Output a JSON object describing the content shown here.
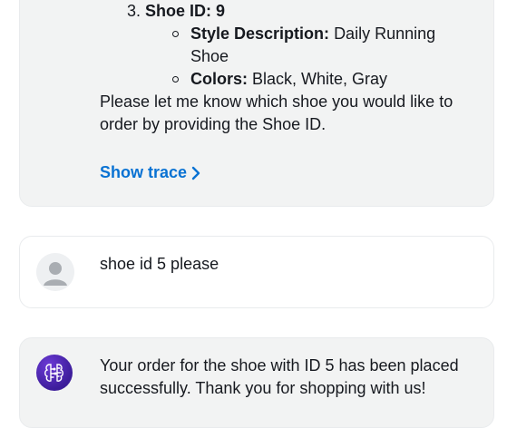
{
  "messages": {
    "bot1": {
      "item3_num": "3.",
      "item3_title": "Shoe ID: 9",
      "style_label": "Style Description:",
      "style_value_1": "Daily Running",
      "style_value_2": "Shoe",
      "colors_label": "Colors:",
      "colors_value": "Black, White, Gray",
      "prompt_line1": "Please let me know which shoe you would like to",
      "prompt_line2": "order by providing the Shoe ID.",
      "show_trace": "Show trace"
    },
    "user1": {
      "text": "shoe id 5 please"
    },
    "bot2": {
      "line1": "Your order for the shoe with ID 5 has been placed",
      "line2": "successfully. Thank you for shopping with us!"
    }
  },
  "icons": {
    "user_avatar": "user-avatar-icon",
    "bot_avatar": "bot-brain-icon",
    "trace_chevron": "chevron-right-icon"
  },
  "colors": {
    "bot_bubble": "#f2f3f3",
    "link": "#0972d3",
    "bot_avatar": "#4b2bb3"
  }
}
